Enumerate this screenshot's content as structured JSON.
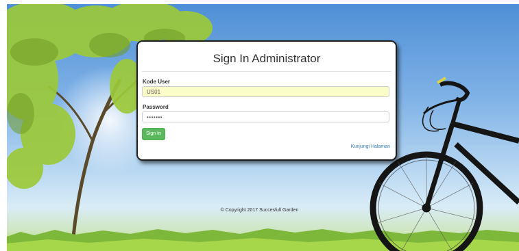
{
  "login": {
    "title": "Sign In Administrator",
    "user_label": "Kode User",
    "user_value": "US01",
    "password_label": "Password",
    "password_value": "•••••••",
    "submit_label": "Sign In",
    "visit_link": "Kunjungi Halaman"
  },
  "footer": {
    "copyright": "© Copyright 2017 Succesfull Garden"
  },
  "colors": {
    "primary_button": "#5cb85c",
    "link": "#337ab7",
    "autofill_bg": "#fafdc8"
  },
  "background": {
    "scene": "tree-sky-bicycle-grass-photo"
  }
}
